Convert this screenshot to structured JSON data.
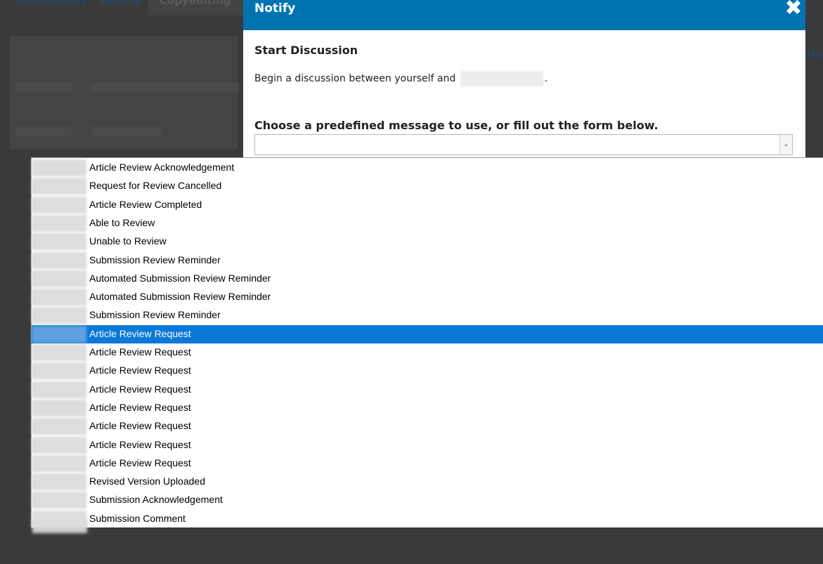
{
  "background": {
    "tabs": [
      "Submission",
      "Review",
      "Copyediting"
    ],
    "right_link": "Upl"
  },
  "modal": {
    "title": "Notify",
    "close_glyph": "✖",
    "section_title": "Start Discussion",
    "intro_prefix": "Begin a discussion between yourself and",
    "intro_suffix": ".",
    "form_label": "Choose a predefined message to use, or fill out the form below.",
    "select_value": "",
    "select_arrow": "⌄"
  },
  "dropdown": {
    "options": [
      "Article Review Acknowledgement",
      "Request for Review Cancelled",
      "Article Review Completed",
      "Able to Review",
      "Unable to Review",
      "Submission Review Reminder",
      "Automated Submission Review Reminder",
      "Automated Submission Review Reminder",
      "Submission Review Reminder",
      "Article Review Request",
      "Article Review Request",
      "Article Review Request",
      "Article Review Request",
      "Article Review Request",
      "Article Review Request",
      "Article Review Request",
      "Article Review Request",
      "Revised Version Uploaded",
      "Submission Acknowledgement",
      "Submission Comment"
    ],
    "selected_index": 9
  },
  "colors": {
    "header": "#0073b0",
    "selection": "#0a78d7",
    "overlay": "#3a3a3a"
  }
}
